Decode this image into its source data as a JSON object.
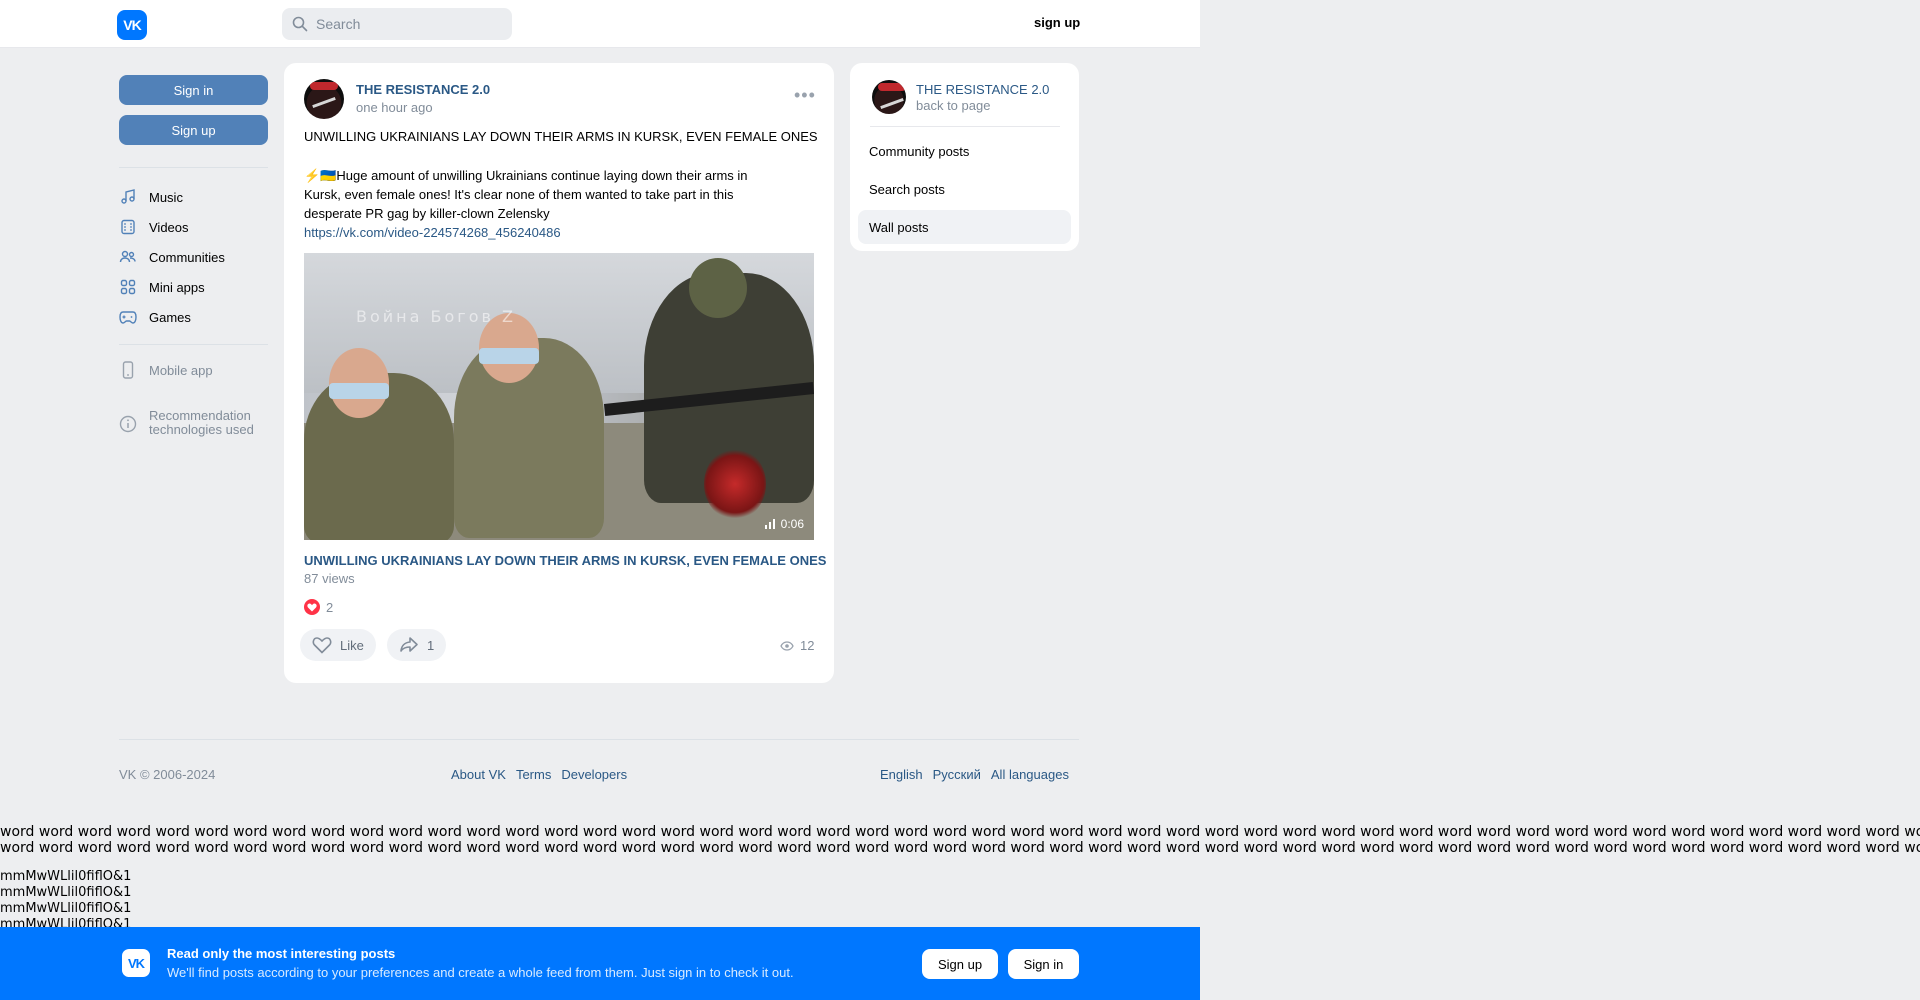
{
  "header": {
    "logo": "VK",
    "search_placeholder": "Search",
    "signup_link": "sign up"
  },
  "sidebar": {
    "sign_in": "Sign in",
    "sign_up": "Sign up",
    "items": [
      {
        "label": "Music",
        "icon": "music-icon"
      },
      {
        "label": "Videos",
        "icon": "videos-icon"
      },
      {
        "label": "Communities",
        "icon": "communities-icon"
      },
      {
        "label": "Mini apps",
        "icon": "mini-apps-icon"
      },
      {
        "label": "Games",
        "icon": "games-icon"
      }
    ],
    "mobile_app": "Mobile app",
    "recommendation_line1": "Recommendation",
    "recommendation_line2": "technologies used"
  },
  "post": {
    "author": "THE RESISTANCE 2.0",
    "time": "one hour ago",
    "title": "UNWILLING UKRAINIANS LAY DOWN THEIR ARMS IN KURSK, EVEN FEMALE ONES",
    "emoji": "⚡🇺🇦",
    "body_line1": "Huge amount of unwilling Ukrainians continue laying down their arms in",
    "body_line2": "Kursk, even female ones! It's clear none of them wanted to take part in this",
    "body_line3": "desperate PR gag by killer-clown Zelensky",
    "link": "https://vk.com/video-224574268_456240486",
    "video": {
      "watermark": "Война Богов Z",
      "duration": "0:06",
      "title": "UNWILLING UKRAINIANS LAY DOWN THEIR ARMS IN KURSK, EVEN FEMALE ONES",
      "views": "87 views"
    },
    "reactions_count": "2",
    "like_label": "Like",
    "share_count": "1",
    "views_count": "12"
  },
  "right_card": {
    "name": "THE RESISTANCE 2.0",
    "back": "back to page",
    "links": [
      "Community posts",
      "Search posts",
      "Wall posts"
    ]
  },
  "footer": {
    "copyright": "VK © 2006-2024",
    "links": [
      "About VK",
      "Terms",
      "Developers"
    ],
    "languages": [
      "English",
      "Русский",
      "All languages"
    ]
  },
  "debug": {
    "words_line1": "word word word word word word word word word word word word word word word word word word word word word word word word word word word word word word word word word word word word word word word word word word word word word word word word word word word word word word word word word word word word word word word",
    "words_line2": "word word word word word word word word word word word word word word word word word word word word word word word word word word word word word word word word word word word word word word word word word word word word word word word word word word word word word word word word word word word word word word word",
    "m_line": "mmMwWLlil0fiflO&1"
  },
  "banner": {
    "logo": "VK",
    "title": "Read only the most interesting posts",
    "subtitle": "We'll find posts according to your preferences and create a whole feed from them. Just sign in to check it out.",
    "sign_up": "Sign up",
    "sign_in": "Sign in"
  },
  "colors": {
    "brand": "#0077ff",
    "button": "#5181b8",
    "link": "#2a5885",
    "background": "#edeef0"
  }
}
